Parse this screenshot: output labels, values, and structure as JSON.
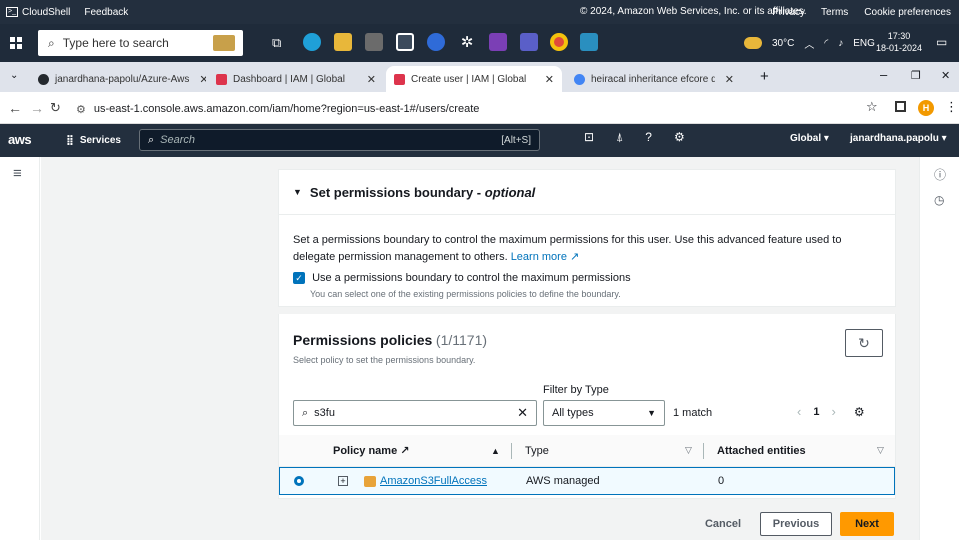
{
  "aws_footer": {
    "cloudshell": "CloudShell",
    "feedback": "Feedback",
    "copyright": "© 2024, Amazon Web Services, Inc. or its affiliates.",
    "privacy": "Privacy",
    "terms": "Terms",
    "cookies": "Cookie preferences"
  },
  "taskbar": {
    "search_placeholder": "Type here to search",
    "weather": "30°C",
    "lang": "ENG",
    "time": "17:30",
    "date": "18-01-2024"
  },
  "tabs": [
    {
      "label": "janardhana-papolu/Azure-Aws",
      "color": "#24292e"
    },
    {
      "label": "Dashboard | IAM | Global",
      "color": "#dd344c"
    },
    {
      "label": "Create user | IAM | Global",
      "color": "#dd344c"
    },
    {
      "label": "heiracal inheritance efcore don",
      "color": "#4285f4"
    }
  ],
  "address": {
    "url": "us-east-1.console.aws.amazon.com/iam/home?region=us-east-1#/users/create",
    "profile_initial": "H"
  },
  "aws_nav": {
    "logo": "aws",
    "services": "Services",
    "search_placeholder": "Search",
    "hotkey": "[Alt+S]",
    "region": "Global ▾",
    "user": "janardhana.papolu ▾"
  },
  "boundary": {
    "title": "Set permissions boundary - ",
    "title_optional": "optional",
    "description": "Set a permissions boundary to control the maximum permissions for this user. Use this advanced feature used to delegate permission management to others.",
    "learn_more": "Learn more",
    "checkbox_label": "Use a permissions boundary to control the maximum permissions",
    "checkbox_hint": "You can select one of the existing permissions policies to define the boundary."
  },
  "policies": {
    "title": "Permissions policies",
    "count": "(1/1171)",
    "subtitle": "Select policy to set the permissions boundary.",
    "filter_label": "Filter by Type",
    "search_value": "s3fu",
    "type_value": "All types",
    "match": "1 match",
    "page": "1",
    "columns": {
      "name": "Policy name",
      "type": "Type",
      "entities": "Attached entities"
    },
    "rows": [
      {
        "name": "AmazonS3FullAccess",
        "type": "AWS managed",
        "entities": "0"
      }
    ]
  },
  "actions": {
    "cancel": "Cancel",
    "previous": "Previous",
    "next": "Next"
  }
}
